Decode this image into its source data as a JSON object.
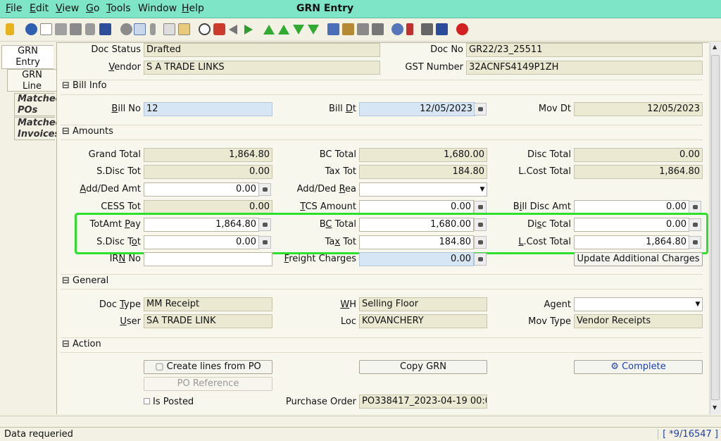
{
  "window": {
    "title": "GRN Entry"
  },
  "menu": [
    {
      "pre": "",
      "u": "F",
      "post": "ile"
    },
    {
      "pre": "",
      "u": "E",
      "post": "dit"
    },
    {
      "pre": "",
      "u": "V",
      "post": "iew"
    },
    {
      "pre": "",
      "u": "G",
      "post": "o"
    },
    {
      "pre": "",
      "u": "T",
      "post": "ools"
    },
    {
      "pre": "",
      "u": "",
      "post": "Window"
    },
    {
      "pre": "",
      "u": "H",
      "post": "elp"
    }
  ],
  "toolbar_icons": [
    "undo-icon",
    "help-icon",
    "new-icon",
    "copy-icon",
    "delete-icon",
    "delete-selection-icon",
    "save-icon",
    "refresh-icon",
    "find-icon",
    "attachment-icon",
    "chat-icon",
    "grid-toggle-icon",
    "history-icon",
    "home-icon",
    "back-icon",
    "forward-icon",
    "first-record-icon",
    "previous-record-icon",
    "next-record-icon",
    "last-record-icon",
    "report-icon",
    "archive-icon",
    "print-preview-icon",
    "print-icon",
    "zoom-across-icon",
    "workflow-icon",
    "requests-icon",
    "product-info-icon",
    "close-window-icon"
  ],
  "tabs": [
    {
      "l1": "GRN",
      "l2": "Entry"
    },
    {
      "l1": "GRN",
      "l2": "Line"
    },
    {
      "l1": "Matched",
      "l2": "POs"
    },
    {
      "l1": "Matched",
      "l2": "Invoices"
    }
  ],
  "header": {
    "doc_status_label": "Doc Status",
    "doc_status": "Drafted",
    "doc_no_label": "Doc No",
    "doc_no": "GR22/23_25511",
    "vendor_label_u": "V",
    "vendor_label": "endor",
    "vendor": "S A TRADE LINKS",
    "gst_label": "GST Number",
    "gst": "32ACNFS4149P1ZH"
  },
  "bill_info": {
    "section": "Bill Info",
    "bill_no_u": "B",
    "bill_no_label": "ill No",
    "bill_no": "12",
    "bill_dt_pre": "Bill ",
    "bill_dt_u": "D",
    "bill_dt_post": "t",
    "bill_dt": "12/05/2023",
    "mov_dt_label": "Mov Dt",
    "mov_dt": "12/05/2023"
  },
  "amounts": {
    "section": "Amounts",
    "grand_total_label": "Grand Total",
    "grand_total": "1,864.80",
    "bc_total_label": "BC Total",
    "bc_total": "1,680.00",
    "disc_total_label": "Disc Total",
    "disc_total": "0.00",
    "sdisc_tot_label": "S.Disc Tot",
    "sdisc_tot": "0.00",
    "tax_tot_label": "Tax Tot",
    "tax_tot": "184.80",
    "lcost_total_label": "L.Cost Total",
    "lcost_total": "1,864.80",
    "add_ded_amt_u": "A",
    "add_ded_amt_label": "dd/Ded Amt",
    "add_ded_amt": "0.00",
    "add_ded_rea_pre": "Add/Ded ",
    "add_ded_rea_u": "R",
    "add_ded_rea_post": "ea",
    "add_ded_rea": "",
    "cess_tot_label": "CESS Tot",
    "cess_tot": "0.00",
    "tcs_amount_u": "T",
    "tcs_amount_label": "CS Amount",
    "tcs_amount": "0.00",
    "bill_disc_pre": "B",
    "bill_disc_u": "i",
    "bill_disc_post": "ll Disc Amt",
    "bill_disc_amt": "0.00",
    "totamt_pay_pre": "TotAmt ",
    "totamt_pay_u": "P",
    "totamt_pay_post": "ay",
    "totamt_pay": "1,864.80",
    "bc_total2_pre": "B",
    "bc_total2_u": "C",
    "bc_total2_post": " Total",
    "bc_total2": "1,680.00",
    "disc_total2_pre": "Di",
    "disc_total2_u": "s",
    "disc_total2_post": "c Total",
    "disc_total2": "0.00",
    "sdisc_tot2_pre": "S.Disc T",
    "sdisc_tot2_u": "o",
    "sdisc_tot2_post": "t",
    "sdisc_tot2": "0.00",
    "tax_tot2_pre": "Ta",
    "tax_tot2_u": "x",
    "tax_tot2_post": " Tot",
    "tax_tot2": "184.80",
    "lcost_total2_pre": "",
    "lcost_total2_u": "L",
    "lcost_total2_post": ".Cost Total",
    "lcost_total2": "1,864.80",
    "irn_no_pre": "IR",
    "irn_no_u": "N",
    "irn_no_post": " No",
    "irn_no": "",
    "freight_u": "F",
    "freight_label": "reight Charges",
    "freight": "0.00",
    "update_btn": "Update Additional Charges"
  },
  "general": {
    "section": "General",
    "doc_type_pre": "Doc ",
    "doc_type_u": "T",
    "doc_type_post": "ype",
    "doc_type": "MM Receipt",
    "wh_u": "W",
    "wh_post": "H",
    "wh": "Selling Floor",
    "agent_label": "Agent",
    "agent": "",
    "user_u": "U",
    "user_post": "ser",
    "user": "SA TRADE LINK",
    "loc_label": "Loc",
    "loc": "KOVANCHERY",
    "mov_type_label": "Mov Type",
    "mov_type": "Vendor Receipts"
  },
  "action": {
    "section": "Action",
    "create_lines": "Create lines from PO",
    "copy_grn": "Copy GRN",
    "complete": "Complete",
    "po_reference": "PO Reference",
    "is_posted": "Is Posted",
    "purchase_order_label": "Purchase Order",
    "purchase_order": "PO338417_2023-04-19 00:0"
  },
  "status": {
    "message": "Data requeried",
    "record": "[ *9/16547 ]"
  },
  "colors": {
    "menubar": "#7ee6c6",
    "highlight": "#2ee02e",
    "panel": "#f8f7ee",
    "readonly_field": "#ebe9d2",
    "mandatory_field": "#d6e6f5"
  }
}
